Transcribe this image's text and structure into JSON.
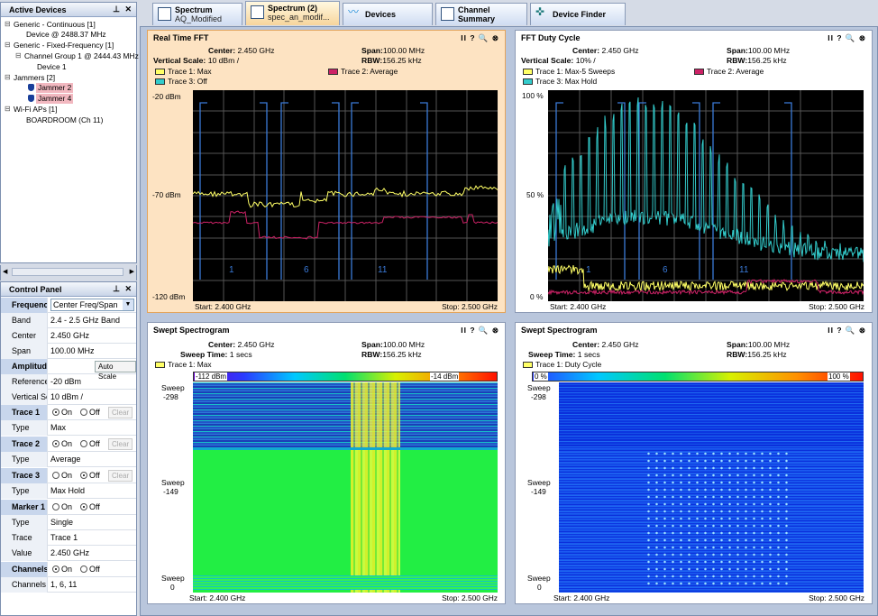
{
  "active_devices": {
    "title": "Active Devices",
    "nodes": [
      {
        "label": "Generic - Continuous [1]",
        "toggle": "−"
      },
      {
        "label": "Device @ 2488.37 MHz"
      },
      {
        "label": "Generic - Fixed-Frequency [1]",
        "toggle": "−"
      },
      {
        "label": "Channel Group 1 @ 2444.43 MHz",
        "toggle": "−"
      },
      {
        "label": "Device 1"
      },
      {
        "label": "Jammers [2]",
        "toggle": "−"
      },
      {
        "label": "Jammer 2"
      },
      {
        "label": "Jammer 4"
      },
      {
        "label": "Wi-Fi APs [1]",
        "toggle": "−"
      },
      {
        "label": "BOARDROOM (Ch 11)"
      }
    ]
  },
  "control_panel": {
    "title": "Control Panel",
    "frequency": {
      "label": "Frequency",
      "mode": "Center Freq/Span",
      "band_label": "Band",
      "band": "2.4 - 2.5 GHz Band",
      "center_label": "Center",
      "center": "2.450 GHz",
      "span_label": "Span",
      "span": "100.00 MHz"
    },
    "amplitude": {
      "label": "Amplitude",
      "autoscale": "Auto Scale",
      "reference_label": "Reference",
      "reference": "-20 dBm",
      "vscale_label": "Vertical Sc.",
      "vscale": "10 dBm /"
    },
    "trace1": {
      "label": "Trace 1",
      "on": "On",
      "off": "Off",
      "clear": "Clear",
      "type_label": "Type",
      "type": "Max"
    },
    "trace2": {
      "label": "Trace 2",
      "on": "On",
      "off": "Off",
      "clear": "Clear",
      "type_label": "Type",
      "type": "Average"
    },
    "trace3": {
      "label": "Trace 3",
      "on": "On",
      "off": "Off",
      "clear": "Clear",
      "type_label": "Type",
      "type": "Max Hold"
    },
    "marker1": {
      "label": "Marker 1",
      "on": "On",
      "off": "Off",
      "type_label": "Type",
      "type": "Single",
      "trace_label": "Trace",
      "trace": "Trace 1",
      "value_label": "Value",
      "value": "2.450 GHz"
    },
    "channels": {
      "label": "Channels",
      "on": "On",
      "off": "Off",
      "list_label": "Channels",
      "list": "1, 6, 11"
    }
  },
  "tabs": [
    {
      "line1": "Spectrum",
      "line2": "AQ_Modified"
    },
    {
      "line1": "Spectrum (2)",
      "line2": "spec_an_modif..."
    },
    {
      "line1": "Devices",
      "line2": ""
    },
    {
      "line1": "Channel",
      "line2": "Summary"
    },
    {
      "line1": "Device Finder",
      "line2": ""
    }
  ],
  "panels": {
    "rt_fft": {
      "title": "Real Time FFT",
      "tools": "II ? 🔍 ⊗",
      "center_label": "Center:",
      "center": "2.450 GHz",
      "span_label": "Span:",
      "span": "100.00 MHz",
      "vscale_label": "Vertical Scale:",
      "vscale": "10 dBm /",
      "rbw_label": "RBW:",
      "rbw": "156.25 kHz",
      "legend": [
        "Trace 1: Max",
        "Trace 2: Average",
        "Trace 3: Off"
      ],
      "y_labels": [
        "-20 dBm",
        "-70 dBm",
        "-120 dBm"
      ],
      "start": "Start: 2.400 GHz",
      "stop": "Stop: 2.500 GHz",
      "channels": [
        "1",
        "6",
        "11"
      ]
    },
    "duty": {
      "title": "FFT Duty Cycle",
      "tools": "II ? 🔍 ⊗",
      "center_label": "Center:",
      "center": "2.450 GHz",
      "span_label": "Span:",
      "span": "100.00 MHz",
      "vscale_label": "Vertical Scale:",
      "vscale": "10% /",
      "rbw_label": "RBW:",
      "rbw": "156.25 kHz",
      "legend": [
        "Trace 1: Max-5 Sweeps",
        "Trace 2: Average",
        "Trace 3: Max Hold"
      ],
      "y_labels": [
        "100 %",
        "50 %",
        "0 %"
      ],
      "start": "Start: 2.400 GHz",
      "stop": "Stop: 2.500 GHz",
      "channels": [
        "1",
        "6",
        "11"
      ]
    },
    "spec1": {
      "title": "Swept Spectrogram",
      "tools": "II ? 🔍 ⊗",
      "center_label": "Center:",
      "center": "2.450 GHz",
      "span_label": "Span:",
      "span": "100.00 MHz",
      "sweep_label": "Sweep Time:",
      "sweep": "1 secs",
      "rbw_label": "RBW:",
      "rbw": "156.25 kHz",
      "legend": [
        "Trace 1: Max"
      ],
      "cbar_min": "-112 dBm",
      "cbar_max": "-14 dBm",
      "sweep_labels": [
        "Sweep",
        "-298",
        "Sweep",
        "-149",
        "Sweep",
        "0"
      ],
      "start": "Start: 2.400 GHz",
      "stop": "Stop: 2.500 GHz"
    },
    "spec2": {
      "title": "Swept Spectrogram",
      "tools": "II ? 🔍 ⊗",
      "center_label": "Center:",
      "center": "2.450 GHz",
      "span_label": "Span:",
      "span": "100.00 MHz",
      "sweep_label": "Sweep Time:",
      "sweep": "1 secs",
      "rbw_label": "RBW:",
      "rbw": "156.25 kHz",
      "legend": [
        "Trace 1: Duty Cycle"
      ],
      "cbar_min": "0 %",
      "cbar_max": "100 %",
      "sweep_labels": [
        "Sweep",
        "-298",
        "Sweep",
        "-149",
        "Sweep",
        "0"
      ],
      "start": "Start: 2.400 GHz",
      "stop": "Stop: 2.500 GHz"
    }
  },
  "colors": {
    "trace1": "#ffff66",
    "trace2": "#cc2266",
    "trace3": "#33cccc",
    "channel": "#3a7ad8"
  }
}
